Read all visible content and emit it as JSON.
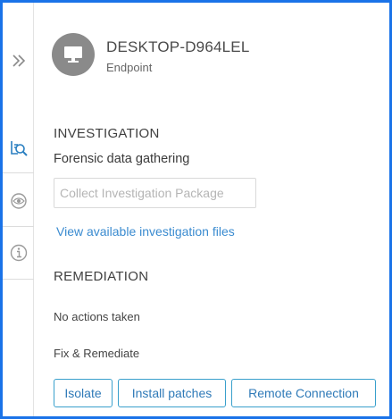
{
  "device": {
    "name": "DESKTOP-D964LEL",
    "type": "Endpoint"
  },
  "rail": {
    "icons": [
      "expand-icon",
      "investigate-icon",
      "watch-icon",
      "info-icon"
    ]
  },
  "investigation": {
    "title": "INVESTIGATION",
    "subtitle": "Forensic data gathering",
    "collect_button": "Collect Investigation Package",
    "view_link": "View available investigation files"
  },
  "remediation": {
    "title": "REMEDIATION",
    "status": "No actions taken",
    "fix_label": "Fix & Remediate",
    "buttons": [
      "Isolate",
      "Install patches",
      "Remote Connection"
    ]
  },
  "colors": {
    "accent": "#1a73e8",
    "link": "#3a8bd0",
    "button_border": "#39a0cc",
    "rail_icon": "#2a7fc1"
  }
}
